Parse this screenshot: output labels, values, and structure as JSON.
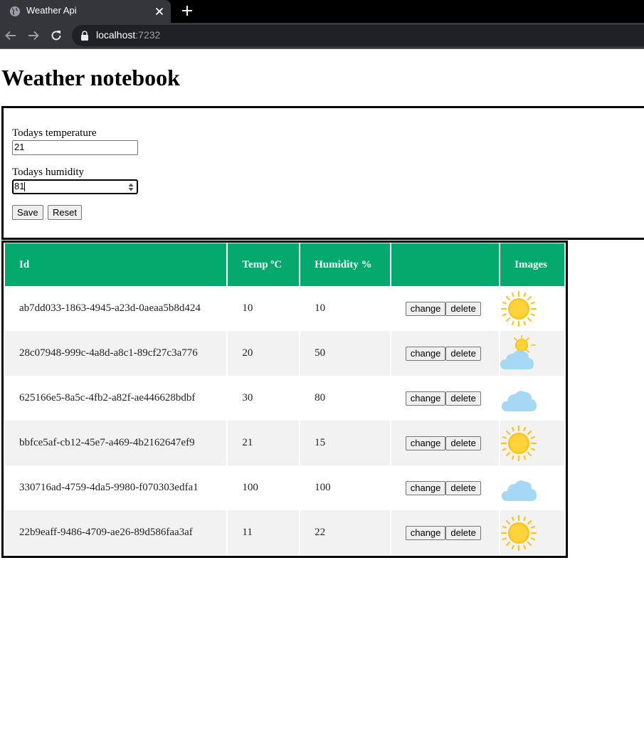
{
  "browser": {
    "tab_title": "Weather Api",
    "url_host": "localhost",
    "url_port": ":7232"
  },
  "page": {
    "title": "Weather notebook"
  },
  "form": {
    "temperature_label": "Todays temperature",
    "temperature_value": "21",
    "humidity_label": "Todays humidity",
    "humidity_value": "81",
    "save_label": "Save",
    "reset_label": "Reset"
  },
  "table": {
    "headers": [
      "Id",
      "Temp ºC",
      "Humidity %",
      "",
      "Images"
    ],
    "change_label": "change",
    "delete_label": "delete",
    "rows": [
      {
        "id": "ab7dd033-1863-4945-a23d-0aeaa5b8d424",
        "temp": "10",
        "humidity": "10",
        "image": "sun-icon"
      },
      {
        "id": "28c07948-999c-4a8d-a8c1-89cf27c3a776",
        "temp": "20",
        "humidity": "50",
        "image": "partly-cloudy-icon"
      },
      {
        "id": "625166e5-8a5c-4fb2-a82f-ae446628bdbf",
        "temp": "30",
        "humidity": "80",
        "image": "cloud-icon"
      },
      {
        "id": "bbfce5af-cb12-45e7-a469-4b2162647ef9",
        "temp": "21",
        "humidity": "15",
        "image": "sun-icon"
      },
      {
        "id": "330716ad-4759-4da5-9980-f070303edfa1",
        "temp": "100",
        "humidity": "100",
        "image": "cloud-icon"
      },
      {
        "id": "22b9eaff-9486-4709-ae26-89d586faa3af",
        "temp": "11",
        "humidity": "22",
        "image": "sun-icon"
      }
    ]
  },
  "colors": {
    "header_bg": "#04aa6d",
    "even_row_bg": "#f2f2f2",
    "sun": "#fcc419",
    "cloud": "#a5d8f5"
  }
}
